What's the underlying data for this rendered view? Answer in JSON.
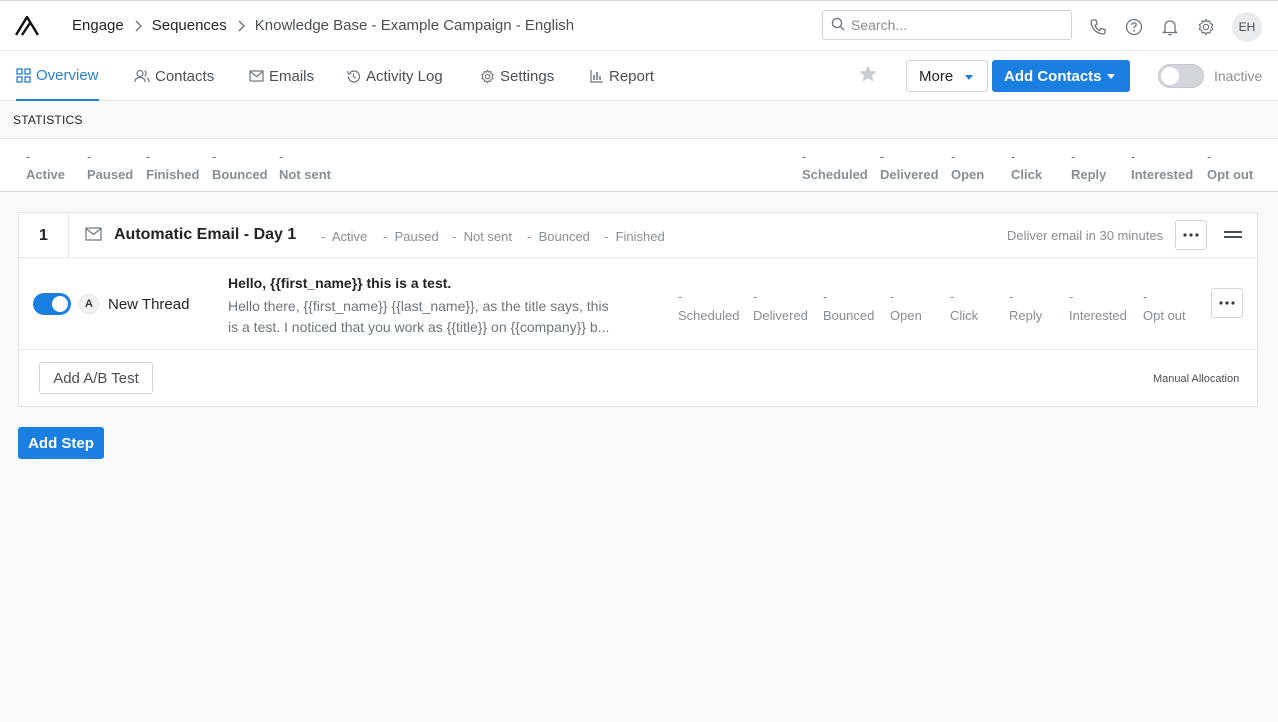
{
  "header": {
    "breadcrumbs": [
      "Engage",
      "Sequences",
      "Knowledge Base - Example Campaign - English"
    ],
    "search_placeholder": "Search...",
    "avatar_initials": "EH"
  },
  "tabs": [
    {
      "label": "Overview",
      "icon": "grid-icon",
      "active": true
    },
    {
      "label": "Contacts",
      "icon": "users-icon"
    },
    {
      "label": "Emails",
      "icon": "mail-icon"
    },
    {
      "label": "Activity Log",
      "icon": "history-icon"
    },
    {
      "label": "Settings",
      "icon": "gear-icon"
    },
    {
      "label": "Report",
      "icon": "bar-chart-icon"
    }
  ],
  "actions": {
    "more_label": "More",
    "add_contacts_label": "Add Contacts",
    "status_label": "Inactive",
    "active": false
  },
  "statistics": {
    "heading": "STATISTICS",
    "left": [
      {
        "label": "Active",
        "value": "-"
      },
      {
        "label": "Paused",
        "value": "-"
      },
      {
        "label": "Finished",
        "value": "-"
      },
      {
        "label": "Bounced",
        "value": "-"
      },
      {
        "label": "Not sent",
        "value": "-"
      }
    ],
    "right": [
      {
        "label": "Scheduled",
        "value": "-"
      },
      {
        "label": "Delivered",
        "value": "-"
      },
      {
        "label": "Open",
        "value": "-"
      },
      {
        "label": "Click",
        "value": "-"
      },
      {
        "label": "Reply",
        "value": "-"
      },
      {
        "label": "Interested",
        "value": "-"
      },
      {
        "label": "Opt out",
        "value": "-"
      }
    ]
  },
  "step": {
    "number": "1",
    "title": "Automatic Email - Day 1",
    "stats": [
      {
        "value": "-",
        "label": "Active"
      },
      {
        "value": "-",
        "label": "Paused"
      },
      {
        "value": "-",
        "label": "Not sent"
      },
      {
        "value": "-",
        "label": "Bounced"
      },
      {
        "value": "-",
        "label": "Finished"
      }
    ],
    "delivery": "Deliver email in 30 minutes",
    "variant": {
      "enabled": true,
      "letter": "A",
      "thread": "New Thread",
      "subject": "Hello, {{first_name}} this is a test.",
      "body_line1": "Hello there, {{first_name}} {{last_name}}, as the title says, this",
      "body_line2": "is a test. I noticed that you work as {{title}} on {{company}} b...",
      "stats": [
        {
          "value": "-",
          "label": "Scheduled"
        },
        {
          "value": "-",
          "label": "Delivered"
        },
        {
          "value": "-",
          "label": "Bounced"
        },
        {
          "value": "-",
          "label": "Open"
        },
        {
          "value": "-",
          "label": "Click"
        },
        {
          "value": "-",
          "label": "Reply"
        },
        {
          "value": "-",
          "label": "Interested"
        },
        {
          "value": "-",
          "label": "Opt out"
        }
      ]
    },
    "add_ab_label": "Add A/B Test",
    "allocation": "Manual Allocation"
  },
  "add_step_label": "Add Step",
  "colors": {
    "primary": "#1a7fe0",
    "active_tab": "#2b7dd1",
    "muted": "#868e96"
  }
}
